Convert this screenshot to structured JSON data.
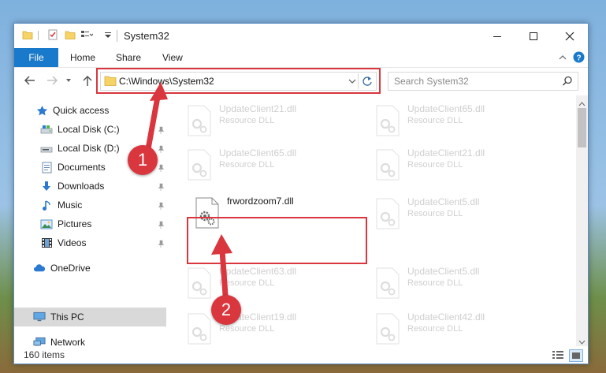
{
  "window": {
    "title": "System32"
  },
  "ribbon": {
    "file": "File",
    "tabs": [
      "Home",
      "Share",
      "View"
    ]
  },
  "address": {
    "path": "C:\\Windows\\System32"
  },
  "search": {
    "placeholder": "Search System32"
  },
  "nav": {
    "quick_access": "Quick access",
    "items": [
      {
        "label": "Local Disk (C:)",
        "icon": "drive-icon",
        "pinned": true
      },
      {
        "label": "Local Disk (D:)",
        "icon": "drive-icon",
        "pinned": true
      },
      {
        "label": "Documents",
        "icon": "documents-icon",
        "pinned": true
      },
      {
        "label": "Downloads",
        "icon": "downloads-icon",
        "pinned": true
      },
      {
        "label": "Music",
        "icon": "music-icon",
        "pinned": true
      },
      {
        "label": "Pictures",
        "icon": "pictures-icon",
        "pinned": true
      },
      {
        "label": "Videos",
        "icon": "videos-icon",
        "pinned": true
      }
    ],
    "onedrive": "OneDrive",
    "this_pc": "This PC",
    "network": "Network"
  },
  "files": {
    "col1": [
      {
        "name": "UpdateClient21.dll",
        "type": "Resource DLL"
      },
      {
        "name": "UpdateClient65.dll",
        "type": "Resource DLL"
      },
      {
        "name": "frwordzoom7.dll",
        "type": ""
      },
      {
        "name": "UpdateClient63.dll",
        "type": "Resource DLL"
      },
      {
        "name": "UpdateClient19.dll",
        "type": "Resource DLL"
      }
    ],
    "col2": [
      {
        "name": "UpdateClient65.dll",
        "type": "Resource DLL"
      },
      {
        "name": "UpdateClient21.dll",
        "type": "Resource DLL"
      },
      {
        "name": "UpdateClient5.dll",
        "type": "Resource DLL"
      },
      {
        "name": "UpdateClient5.dll",
        "type": "Resource DLL"
      },
      {
        "name": "UpdateClient42.dll",
        "type": "Resource DLL"
      }
    ]
  },
  "status": {
    "items": "160 items"
  },
  "callouts": [
    "1",
    "2"
  ],
  "colors": {
    "accent": "#1979ca",
    "highlight": "#d9363e",
    "selected": "#d9d9d9"
  }
}
